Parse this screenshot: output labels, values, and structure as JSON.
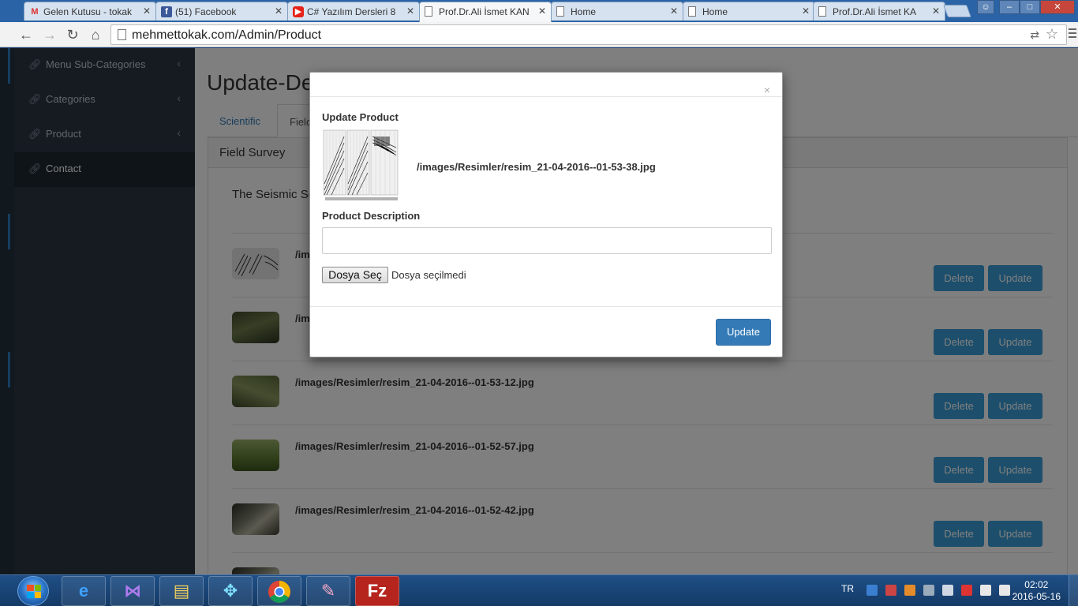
{
  "browser": {
    "tabs": [
      {
        "title": "Gelen Kutusu - tokak",
        "icon": "gmail-icon",
        "active": false
      },
      {
        "title": "(51) Facebook",
        "icon": "facebook-icon",
        "active": false
      },
      {
        "title": "C# Yazılım Dersleri 8",
        "icon": "youtube-icon",
        "active": false
      },
      {
        "title": "Prof.Dr.Ali İsmet KAN",
        "icon": "document-icon",
        "active": true
      },
      {
        "title": "Home",
        "icon": "document-icon",
        "active": false
      },
      {
        "title": "Home",
        "icon": "document-icon",
        "active": false
      },
      {
        "title": "Prof.Dr.Ali İsmet KA",
        "icon": "document-icon",
        "active": false
      }
    ],
    "url": "mehmettokak.com/Admin/Product"
  },
  "sidebar": {
    "items": [
      {
        "label": "Menu Sub-Categories",
        "icon": "link-icon",
        "has_arrow": true
      },
      {
        "label": "Categories",
        "icon": "link-icon",
        "has_arrow": true
      },
      {
        "label": "Product",
        "icon": "link-icon",
        "has_arrow": true
      },
      {
        "label": "Contact",
        "icon": "link-icon",
        "has_arrow": false,
        "active": true
      }
    ]
  },
  "main": {
    "heading": "Update-De",
    "tabs": [
      {
        "label": "Scientific",
        "active": false
      },
      {
        "label": "Fielc",
        "active": true
      }
    ],
    "panel_title": "Field Survey",
    "panel_desc": "The Seismic So",
    "delete_label": "Delete",
    "update_label": "Update",
    "products": [
      {
        "path": "/im",
        "thumb": "seismic"
      },
      {
        "path": "/im",
        "thumb": "field"
      },
      {
        "path": "/images/Resimler/resim_21-04-2016--01-53-12.jpg",
        "thumb": "field2"
      },
      {
        "path": "/images/Resimler/resim_21-04-2016--01-52-57.jpg",
        "thumb": "grass"
      },
      {
        "path": "/images/Resimler/resim_21-04-2016--01-52-42.jpg",
        "thumb": "person"
      }
    ]
  },
  "modal": {
    "close_label": "×",
    "title": "Update Product",
    "image_path": "/images/Resimler/resim_21-04-2016--01-53-38.jpg",
    "description_label": "Product Description",
    "description_value": "",
    "file_button": "Dosya Seç",
    "file_status": "Dosya seçilmedi",
    "submit_label": "Update"
  },
  "taskbar": {
    "language": "TR",
    "time": "02:02",
    "date": "2016-05-16"
  },
  "colors": {
    "sidebar_bg": "#2b3643",
    "primary": "#337ab7",
    "row_button": "#3a9fd8"
  }
}
